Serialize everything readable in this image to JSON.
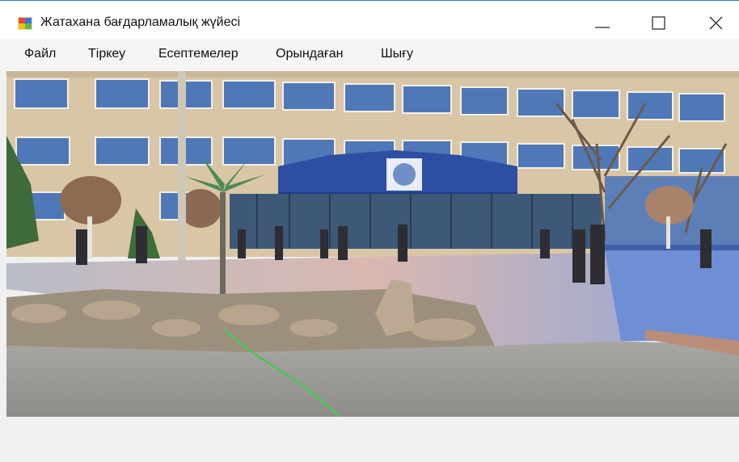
{
  "window": {
    "title": "Жатахана бағдарламалық жүйесі"
  },
  "menu": [
    {
      "id": "file",
      "label": "Файл"
    },
    {
      "id": "register",
      "label": "Тіркеу"
    },
    {
      "id": "reports",
      "label": "Есептемелер"
    },
    {
      "id": "executed",
      "label": "Орындаған"
    },
    {
      "id": "exit",
      "label": "Шығу"
    }
  ],
  "icons": {
    "app": "app-window-icon",
    "minimize": "minimize-icon",
    "maximize": "maximize-icon",
    "close": "close-icon"
  },
  "colors": {
    "title_border": "#3b7bbf",
    "building_blue": "#2c4fa3",
    "sky": "#dfe6ee"
  }
}
